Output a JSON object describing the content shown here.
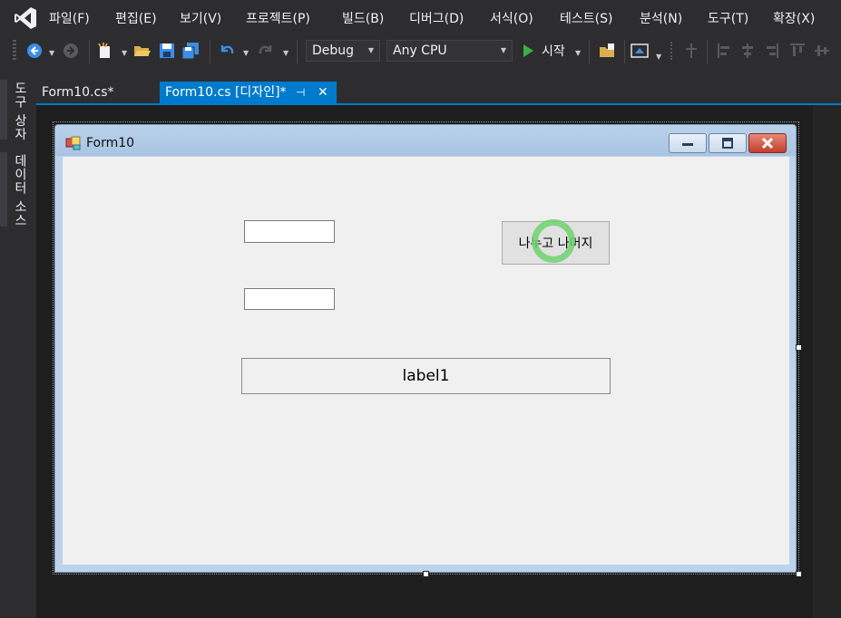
{
  "menu": {
    "items": [
      "파일(F)",
      "편집(E)",
      "보기(V)",
      "프로젝트(P)",
      "빌드(B)",
      "디버그(D)",
      "서식(O)",
      "테스트(S)",
      "분석(N)",
      "도구(T)",
      "확장(X)"
    ]
  },
  "toolbar": {
    "configuration": "Debug",
    "platform": "Any CPU",
    "start_label": "시작"
  },
  "tabs": {
    "items": [
      {
        "label": "Form10.cs*"
      },
      {
        "label": "Form10.cs [디자인]*"
      }
    ],
    "pin_glyph": "⊣",
    "close_glyph": "✕"
  },
  "side_panel": {
    "toolbox": "도구 상자",
    "data_sources": "데이터 소스"
  },
  "form": {
    "title": "Form10",
    "button_label": "나누고 나머지",
    "label_text": "label1",
    "textbox1_value": "",
    "textbox2_value": ""
  },
  "colors": {
    "accent": "#007acc",
    "ide_background": "#2d2d30",
    "play_green": "#3cb043",
    "cursor_ring": "#6ed26e"
  }
}
